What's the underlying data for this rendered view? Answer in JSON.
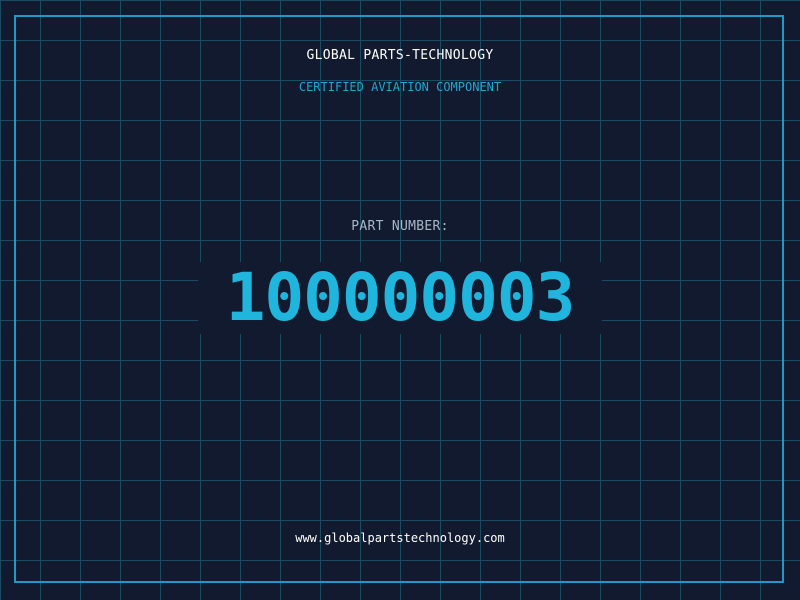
{
  "header": {
    "company": "GLOBAL PARTS-TECHNOLOGY",
    "subtitle": "CERTIFIED AVIATION COMPONENT"
  },
  "part": {
    "label": "PART NUMBER:",
    "number": "100000003"
  },
  "footer": {
    "url": "www.globalpartstechnology.com"
  },
  "colors": {
    "background": "#111a2e",
    "grid": "#1b4a63",
    "frame": "#1d9bc6",
    "accent": "#1fb5dc",
    "label": "#a9b8c8",
    "text": "#ffffff"
  }
}
